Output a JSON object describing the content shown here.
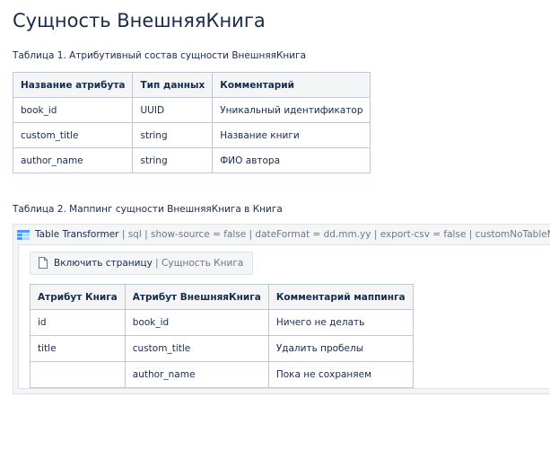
{
  "page": {
    "title": "Сущность ВнешняяКнига"
  },
  "table1": {
    "caption": "Таблица 1. Атрибутивный состав сущности ВнешняяКнига",
    "headers": [
      "Название атрибута",
      "Тип данных",
      "Комментарий"
    ],
    "rows": [
      [
        "book_id",
        "UUID",
        "Уникальный идентификатор"
      ],
      [
        "custom_title",
        "string",
        "Название книги"
      ],
      [
        "author_name",
        "string",
        "ФИО автора"
      ]
    ]
  },
  "table2": {
    "caption": "Таблица 2. Маппинг сущности ВнешняяКнига в Книга"
  },
  "macro": {
    "name": "Table Transformer",
    "params": " | sql | show-source = false | dateFormat = dd.mm.yy | export-csv = false | customNoTableM...",
    "icon": "table-transformer-icon",
    "include": {
      "label": "Включить страницу",
      "separator": " | ",
      "page": "Сущность Книга",
      "icon": "page-icon"
    },
    "headers": [
      "Атрибут Книга",
      "Атрибут ВнешняяКнига",
      "Комментарий маппинга"
    ],
    "rows": [
      [
        "id",
        "book_id",
        "Ничего не делать"
      ],
      [
        "title",
        "custom_title",
        "Удалить пробелы"
      ],
      [
        "",
        "author_name",
        "Пока не сохраняем"
      ]
    ]
  }
}
